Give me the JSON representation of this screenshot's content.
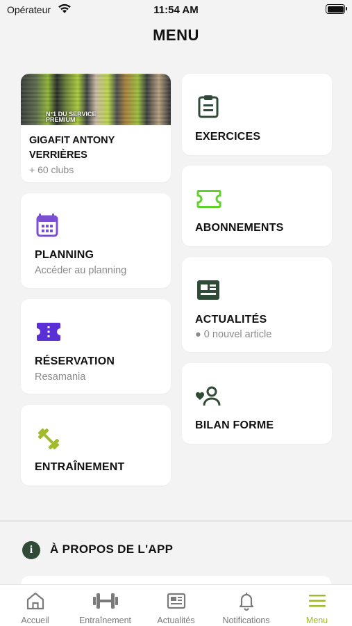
{
  "status_bar": {
    "carrier": "Opérateur",
    "time": "11:54 AM"
  },
  "page": {
    "title": "MENU"
  },
  "club_card": {
    "badge": "N°1 DU SERVICE\nPREMIUM",
    "name": "GIGAFIT ANTONY VERRIÈRES",
    "subtitle": "+ 60 clubs"
  },
  "menu": {
    "planning": {
      "label": "PLANNING",
      "subtitle": "Accéder au planning",
      "icon": "calendar-icon",
      "color": "#7b4fd1"
    },
    "reservation": {
      "label": "RÉSERVATION",
      "subtitle": "Resamania",
      "icon": "ticket-icon",
      "color": "#5a2fd6"
    },
    "entrainement": {
      "label": "ENTRAÎNEMENT",
      "icon": "dumbbell-icon",
      "color": "#9fba2a"
    },
    "exercices": {
      "label": "EXERCICES",
      "icon": "clipboard-icon",
      "color": "#2f4a36"
    },
    "abonnements": {
      "label": "ABONNEMENTS",
      "icon": "ticket-outline-icon",
      "color": "#5fd12a"
    },
    "actualites": {
      "label": "ACTUALITÉS",
      "subtitle": "● 0 nouvel article",
      "icon": "newspaper-icon",
      "color": "#2f4a36"
    },
    "bilan": {
      "label": "BILAN FORME",
      "icon": "heart-person-icon",
      "color": "#2f4a36"
    }
  },
  "about": {
    "title": "À PROPOS DE L'APP"
  },
  "tab_bar": {
    "active_color": "#9fba2a",
    "items": [
      {
        "label": "Accueil",
        "icon": "home-icon"
      },
      {
        "label": "Entraînement",
        "icon": "dumbbell-icon"
      },
      {
        "label": "Actualités",
        "icon": "newspaper-icon"
      },
      {
        "label": "Notifications",
        "icon": "bell-icon"
      },
      {
        "label": "Menu",
        "icon": "menu-icon",
        "active": true
      }
    ]
  }
}
